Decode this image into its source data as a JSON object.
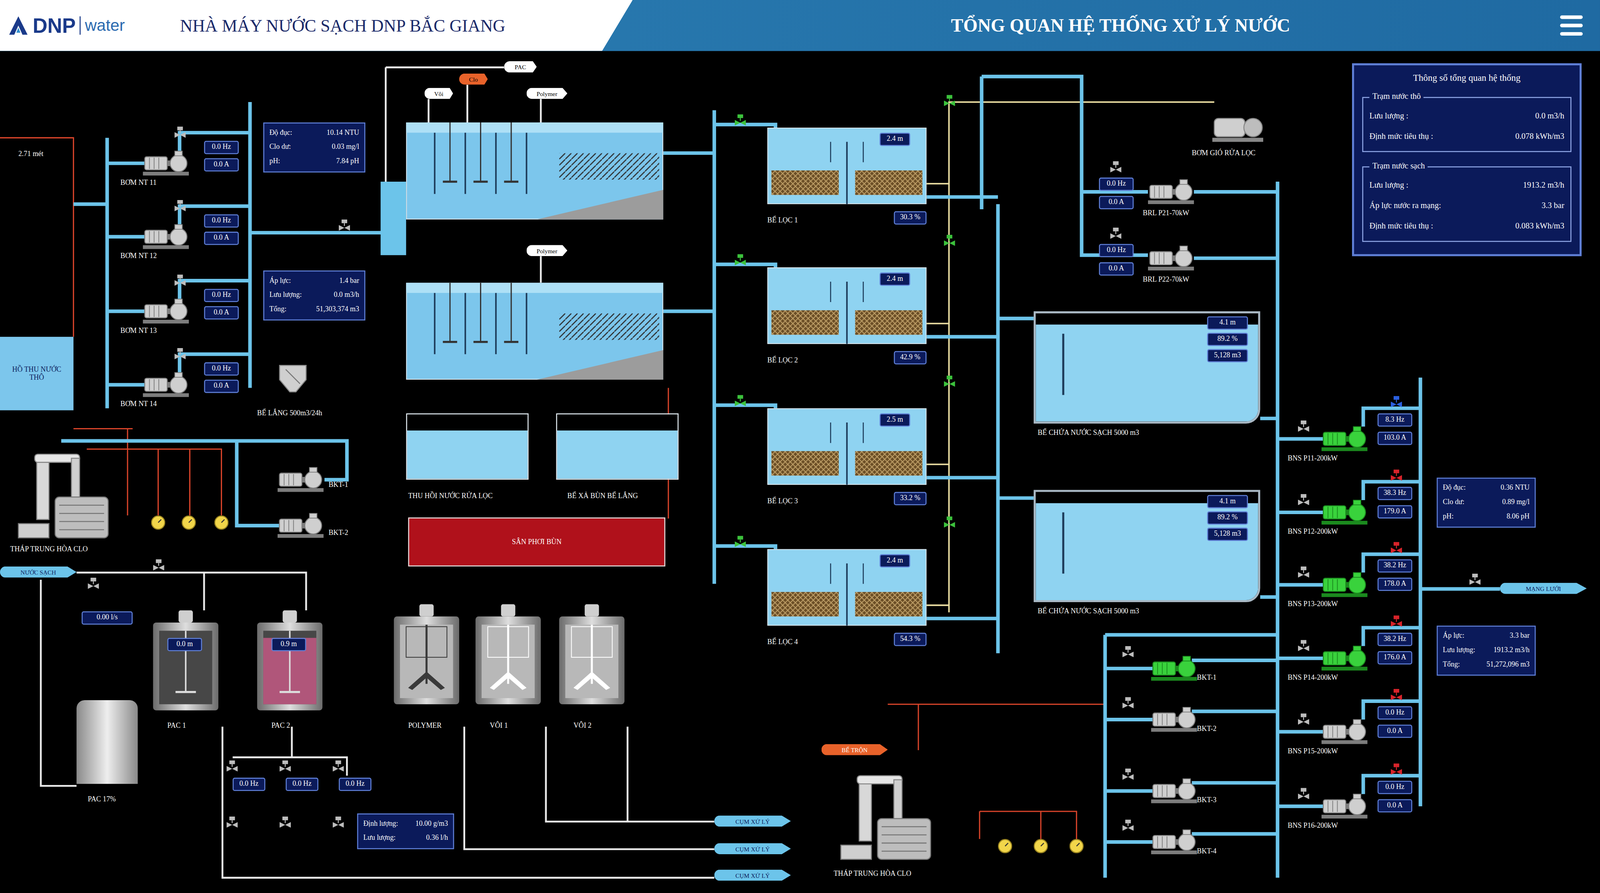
{
  "header": {
    "logo_name": "DNP",
    "logo_suffix": "water",
    "plant_title": "NHÀ MÁY NƯỚC SẠCH DNP BẮC GIANG",
    "page_title": "TỔNG QUAN HỆ THỐNG XỬ LÝ NƯỚC"
  },
  "raw_lake": {
    "label": "HỒ THU NƯỚC THÔ",
    "reading": "2.71 mét"
  },
  "raw_pumps": [
    {
      "name": "BƠM NT 11",
      "hz": "0.0 Hz",
      "current": "0.0 A",
      "running": false
    },
    {
      "name": "BƠM NT 12",
      "hz": "0.0 Hz",
      "current": "0.0 A",
      "running": false
    },
    {
      "name": "BƠM NT 13",
      "hz": "0.0 Hz",
      "current": "0.0 A",
      "running": false
    },
    {
      "name": "BƠM NT 14",
      "hz": "0.0 Hz",
      "current": "0.0 A",
      "running": false
    }
  ],
  "raw_quality": [
    {
      "label": "Độ đục:",
      "value": "10.14 NTU"
    },
    {
      "label": "Clo dư:",
      "value": "0.03 mg/l"
    },
    {
      "label": "pH:",
      "value": "7.84 pH"
    }
  ],
  "raw_flow": [
    {
      "label": "Áp lực:",
      "value": "1.4 bar"
    },
    {
      "label": "Lưu lượng:",
      "value": "0.0 m3/h"
    },
    {
      "label": "Tổng:",
      "value": "51,303,374 m3"
    }
  ],
  "small_settler": {
    "label": "BỂ LẮNG 500m3/24h"
  },
  "left_bkt": [
    {
      "name": "BKT-1",
      "running": false
    },
    {
      "name": "BKT-2",
      "running": false
    }
  ],
  "left_tower": {
    "label": "THÁP TRUNG HÒA CLO"
  },
  "dosing_tags": [
    {
      "label": "PAC",
      "color": "#ffffff"
    },
    {
      "label": "Clo",
      "color": "#e8622a"
    },
    {
      "label": "Vôi",
      "color": "#ffffff"
    },
    {
      "label": "Polymer",
      "color": "#ffffff"
    },
    {
      "label": "Polymer",
      "color": "#ffffff"
    }
  ],
  "sludge": {
    "washwater": "THU HỒI NƯỚC RỬA LỌC",
    "drain": "BỂ XẢ BÙN BỂ LẮNG",
    "drying": "SÂN PHƠI BÙN"
  },
  "filters": [
    {
      "name": "BỂ LỌC 1",
      "depth": "2.4 m",
      "valve": "30.3 %"
    },
    {
      "name": "BỂ LỌC 2",
      "depth": "2.4 m",
      "valve": "42.9 %"
    },
    {
      "name": "BỂ LỌC 3",
      "depth": "2.5 m",
      "valve": "33.2 %"
    },
    {
      "name": "BỂ LỌC 4",
      "depth": "2.4 m",
      "valve": "54.3 %"
    }
  ],
  "blower": {
    "label": "BƠM GIÓ RỬA LỌC"
  },
  "backwash_pumps": [
    {
      "name": "BRL P21-70kW",
      "hz": "0.0 Hz",
      "current": "0.0 A",
      "running": false
    },
    {
      "name": "BRL P22-70kW",
      "hz": "0.0 Hz",
      "current": "0.0 A",
      "running": false
    }
  ],
  "clear_tanks": [
    {
      "name": "BỂ CHỨA NƯỚC SẠCH 5000 m3",
      "depth": "4.1 m",
      "percent": "89.2 %",
      "volume": "5,128 m3",
      "level": 0.892
    },
    {
      "name": "BỂ CHỨA NƯỚC SẠCH 5000 m3",
      "depth": "4.1 m",
      "percent": "89.2 %",
      "volume": "5,128 m3",
      "level": 0.892
    }
  ],
  "high_lift_pumps": [
    {
      "name": "BNS P11-200kW",
      "hz": "8.3 Hz",
      "current": "103.0 A",
      "running": true,
      "valve_color": "#2a5fe0"
    },
    {
      "name": "BNS P12-200kW",
      "hz": "38.3 Hz",
      "current": "179.0 A",
      "running": true,
      "valve_color": "#d8232a"
    },
    {
      "name": "BNS P13-200kW",
      "hz": "38.2 Hz",
      "current": "178.0 A",
      "running": true,
      "valve_color": "#d8232a"
    },
    {
      "name": "BNS P14-200kW",
      "hz": "38.2 Hz",
      "current": "176.0 A",
      "running": true,
      "valve_color": "#d8232a"
    },
    {
      "name": "BNS P15-200kW",
      "hz": "0.0 Hz",
      "current": "0.0 A",
      "running": false,
      "valve_color": "#d8232a"
    },
    {
      "name": "BNS P16-200kW",
      "hz": "0.0 Hz",
      "current": "0.0 A",
      "running": false,
      "valve_color": "#d8232a"
    }
  ],
  "out_quality": [
    {
      "label": "Độ đục:",
      "value": "0.36 NTU"
    },
    {
      "label": "Clo dư:",
      "value": "0.89 mg/l"
    },
    {
      "label": "pH:",
      "value": "8.06 pH"
    }
  ],
  "out_flow": [
    {
      "label": "Áp lực:",
      "value": "3.3 bar"
    },
    {
      "label": "Lưu lượng:",
      "value": "1913.2 m3/h"
    },
    {
      "label": "Tổng:",
      "value": "51,272,096 m3"
    }
  ],
  "network_tag": "MẠNG LƯỚI",
  "right_bkt": [
    {
      "name": "BKT-1",
      "running": true
    },
    {
      "name": "BKT-2",
      "running": false
    },
    {
      "name": "BKT-3",
      "running": false
    },
    {
      "name": "BKT-4",
      "running": false
    }
  ],
  "mixer_tag": "BỂ TRỘN",
  "right_tower": {
    "label": "THÁP TRUNG HÒA CLO"
  },
  "chem": {
    "clean_water_tag": "NƯỚC SẠCH",
    "clean_water_flow": "0.00 l/s",
    "tanks": [
      {
        "name": "PAC 1",
        "kind": "pac",
        "depth": "0.0 m",
        "level": 0.0,
        "color": "#b0567a"
      },
      {
        "name": "PAC 2",
        "kind": "pac",
        "depth": "0.9 m",
        "level": 0.9,
        "color": "#b0567a"
      },
      {
        "name": "POLYMER",
        "kind": "agitator",
        "color": "#3a3a3a"
      },
      {
        "name": "VÔI 1",
        "kind": "agitator",
        "color": "#ffffff"
      },
      {
        "name": "VÔI 2",
        "kind": "agitator",
        "color": "#ffffff"
      }
    ],
    "stock": {
      "name": "PAC 17%"
    },
    "dosing_pumps": [
      {
        "hz": "0.0 Hz"
      },
      {
        "hz": "0.0 Hz"
      },
      {
        "hz": "0.0 Hz"
      }
    ],
    "dosing_info": [
      {
        "label": "Định lượng:",
        "value": "10.00 g/m3"
      },
      {
        "label": "Lưu lượng:",
        "value": "0.36 l/h"
      }
    ],
    "outlets": [
      "CỤM XỬ LÝ",
      "CỤM XỬ LÝ",
      "CỤM XỬ LÝ"
    ]
  },
  "summary": {
    "title": "Thông số tổng quan hệ thống",
    "sections": [
      {
        "title": "Trạm nước thô",
        "rows": [
          {
            "label": "Lưu lượng :",
            "value": "0.0 m3/h"
          },
          {
            "label": "Định mức tiêu thụ :",
            "value": "0.078 kWh/m3"
          }
        ]
      },
      {
        "title": "Trạm nước sạch",
        "rows": [
          {
            "label": "Lưu lượng :",
            "value": "1913.2 m3/h"
          },
          {
            "label": "Áp lực nước ra mạng:",
            "value": "3.3 bar"
          },
          {
            "label": "Định mức tiêu thụ :",
            "value": "0.083 kWh/m3"
          }
        ]
      }
    ]
  }
}
